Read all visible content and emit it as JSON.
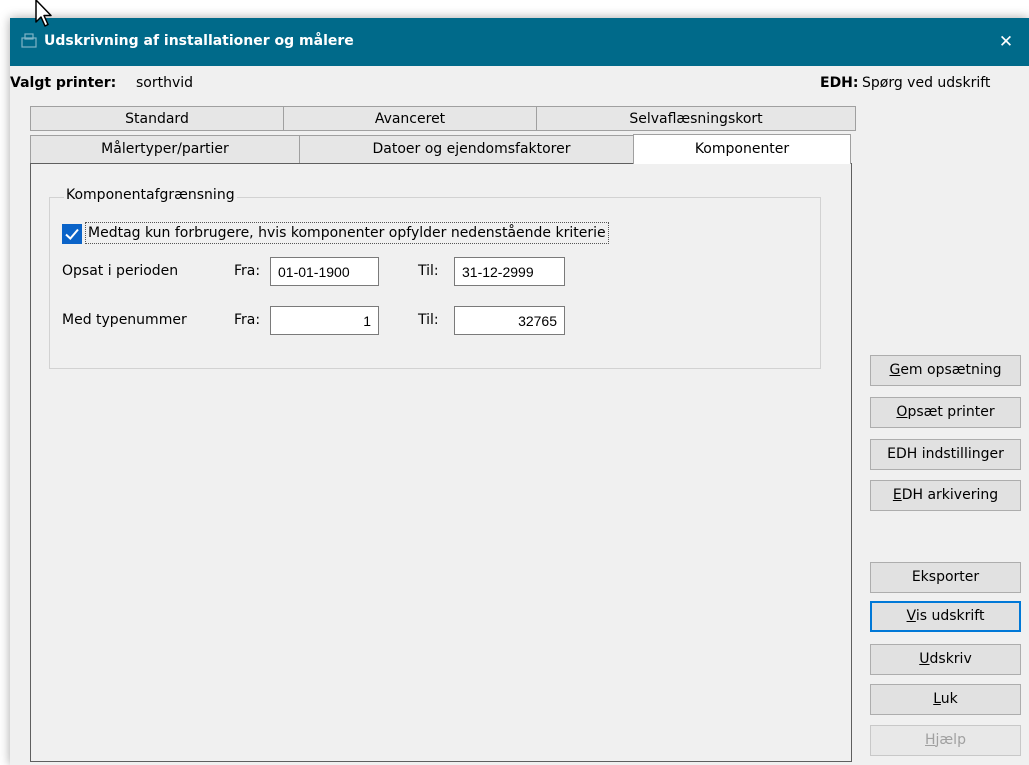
{
  "window": {
    "title": "Udskrivning af installationer og målere",
    "close_glyph": "✕"
  },
  "header": {
    "printer_label": "Valgt printer:",
    "printer_value": "sorthvid",
    "edh_label": "EDH:",
    "edh_value": "Spørg ved udskrift"
  },
  "tabs": {
    "row1": [
      "Standard",
      "Avanceret",
      "Selvaflæsningskort"
    ],
    "row2": [
      "Målertyper/partier",
      "Datoer og ejendomsfaktorer",
      "Komponenter"
    ],
    "active": "Komponenter"
  },
  "group": {
    "legend": "Komponentafgrænsning",
    "checkbox_label": "Medtag kun forbrugere, hvis komponenter opfylder nedenstående kriterie",
    "checkbox_checked": true,
    "row1": {
      "label": "Opsat i perioden",
      "from_label": "Fra:",
      "from_value": "01-01-1900",
      "to_label": "Til:",
      "to_value": "31-12-2999"
    },
    "row2": {
      "label": "Med typenummer",
      "from_label": "Fra:",
      "from_value": "1",
      "to_label": "Til:",
      "to_value": "32765"
    }
  },
  "buttons": {
    "gem": {
      "mnemonic": "G",
      "rest": "em opsætning"
    },
    "opsaet": {
      "mnemonic": "O",
      "rest": "psæt printer"
    },
    "edh_ind": {
      "label": "EDH indstillinger"
    },
    "edh_ark": {
      "mnemonic": "E",
      "rest": "DH arkivering"
    },
    "eksporter": {
      "label": "Eksporter"
    },
    "vis": {
      "mnemonic": "V",
      "rest": "is udskrift"
    },
    "udskriv": {
      "mnemonic": "U",
      "rest": "dskriv"
    },
    "luk": {
      "mnemonic": "L",
      "rest": "uk"
    },
    "hjaelp": {
      "mnemonic": "H",
      "rest": "jælp"
    }
  },
  "colors": {
    "titlebar": "#006a8a",
    "checkbox": "#0a63c8",
    "default_button_border": "#0078d7"
  },
  "icons": {
    "title": "app-icon",
    "close": "close-icon",
    "check": "checkmark-icon",
    "cursor": "mouse-cursor-icon"
  }
}
